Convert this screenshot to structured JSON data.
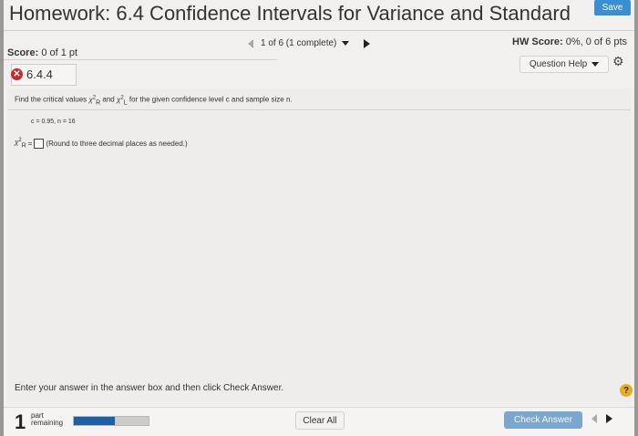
{
  "header": {
    "title": "Homework: 6.4 Confidence Intervals for Variance and Standard",
    "save_label": "Save"
  },
  "status": {
    "score_label": "Score:",
    "score_value": "0 of 1 pt",
    "pager_text": "1 of 6 (1 complete)",
    "hw_score_label": "HW Score:",
    "hw_score_value": "0%, 0 of 6 pts",
    "question_help_label": "Question Help"
  },
  "question": {
    "number": "6.4.4",
    "prompt_start": "Find the critical values",
    "chi_r": "χ",
    "chi_r_sub": "R",
    "and_text": "and",
    "chi_l": "χ",
    "chi_l_sub": "L",
    "prompt_end": "for the given confidence level c and sample size n.",
    "given": "c = 0.95, n = 16",
    "answer_prefix": "χ",
    "answer_prefix_sub": "R",
    "answer_equals": "=",
    "answer_value": "",
    "answer_hint": "(Round to three decimal places as needed.)"
  },
  "footer": {
    "instruction": "Enter your answer in the answer box and then click Check Answer.",
    "parts_number": "1",
    "parts_text_1": "part",
    "parts_text_2": "remaining",
    "progress_fraction": 0.55,
    "clear_all_label": "Clear All",
    "check_answer_label": "Check Answer"
  },
  "colors": {
    "save_button": "#3a8fd2",
    "check_answer_button": "#7ba6cf",
    "progress_fill": "#1f5fa3",
    "incorrect_icon": "#c8282e",
    "help_icon": "#e3ae27"
  }
}
